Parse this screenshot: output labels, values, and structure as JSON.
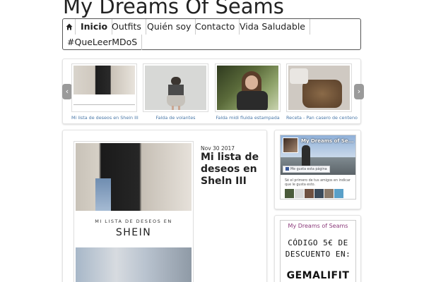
{
  "site": {
    "title": "My Dreams Of Seams"
  },
  "nav": {
    "home_icon": "home-icon",
    "items": [
      {
        "label": "Inicio",
        "active": true
      },
      {
        "label": "Outfits"
      },
      {
        "label": "Quién soy"
      },
      {
        "label": "Contacto"
      },
      {
        "label": "Vida Saludable"
      },
      {
        "label": "#QueLeerMDoS"
      }
    ]
  },
  "slider": {
    "prev_icon": "chevron-left-icon",
    "next_icon": "chevron-right-icon",
    "slides": [
      {
        "caption": "Mi lista de deseos en Shein III"
      },
      {
        "caption": "Falda de volantes"
      },
      {
        "caption": "Falda midi fluida estampada"
      },
      {
        "caption": "Receta - Pan casero de centeno"
      }
    ]
  },
  "post": {
    "date": "Nov 30 2017",
    "title": "Mi lista de deseos en Sheln III",
    "image_text_line1": "MI LISTA DE DESEOS EN",
    "image_text_line2": "SHEIN"
  },
  "facebook": {
    "page_name": "My Dreams of Se...",
    "like_label": "Me gusta esta página",
    "friends_text": "Sé el primero de tus amigos en indicar que le gusta esto."
  },
  "promo": {
    "brand": "My Dreams of Seams",
    "line1": "CÓDIGO 5€ DE",
    "line2": "DESCUENTO EN:",
    "code": "GEMALIFIT"
  },
  "colors": {
    "link": "#4a78a8",
    "promo_brand": "#8b3a7a"
  }
}
